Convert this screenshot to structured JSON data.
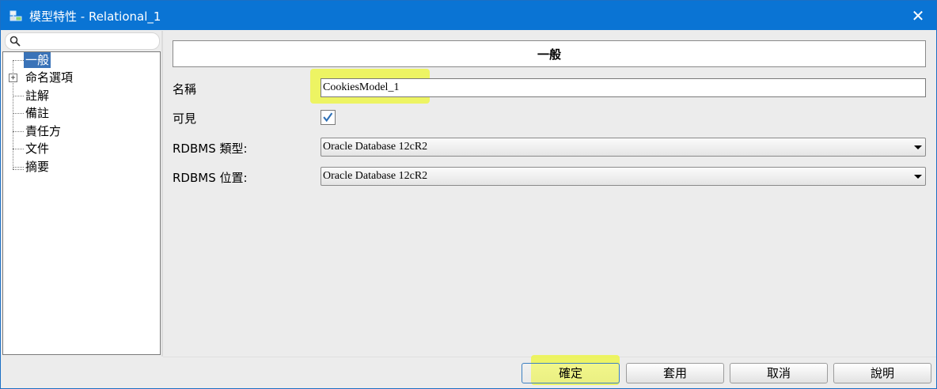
{
  "window": {
    "title": "模型特性 - Relational_1",
    "close_glyph": "✕"
  },
  "tree": {
    "items": [
      {
        "label": "一般",
        "selected": true
      },
      {
        "label": "命名選項",
        "expandable": true,
        "expander": "+"
      },
      {
        "label": "註解"
      },
      {
        "label": "備註"
      },
      {
        "label": "責任方"
      },
      {
        "label": "文件"
      },
      {
        "label": "摘要"
      }
    ]
  },
  "form": {
    "section_title": "一般",
    "name_label": "名稱",
    "name_value": "CookiesModel_1",
    "visible_label": "可見",
    "visible_checked": true,
    "rdbms_type_label": "RDBMS 類型:",
    "rdbms_type_value": "Oracle Database 12cR2",
    "rdbms_site_label": "RDBMS 位置:",
    "rdbms_site_value": "Oracle Database 12cR2"
  },
  "buttons": {
    "ok": "確定",
    "apply": "套用",
    "cancel": "取消",
    "help": "說明"
  },
  "colors": {
    "titlebar": "#0a74d4",
    "selection": "#3a73b8",
    "highlight": "#edf63c",
    "check": "#2d6fb6"
  }
}
